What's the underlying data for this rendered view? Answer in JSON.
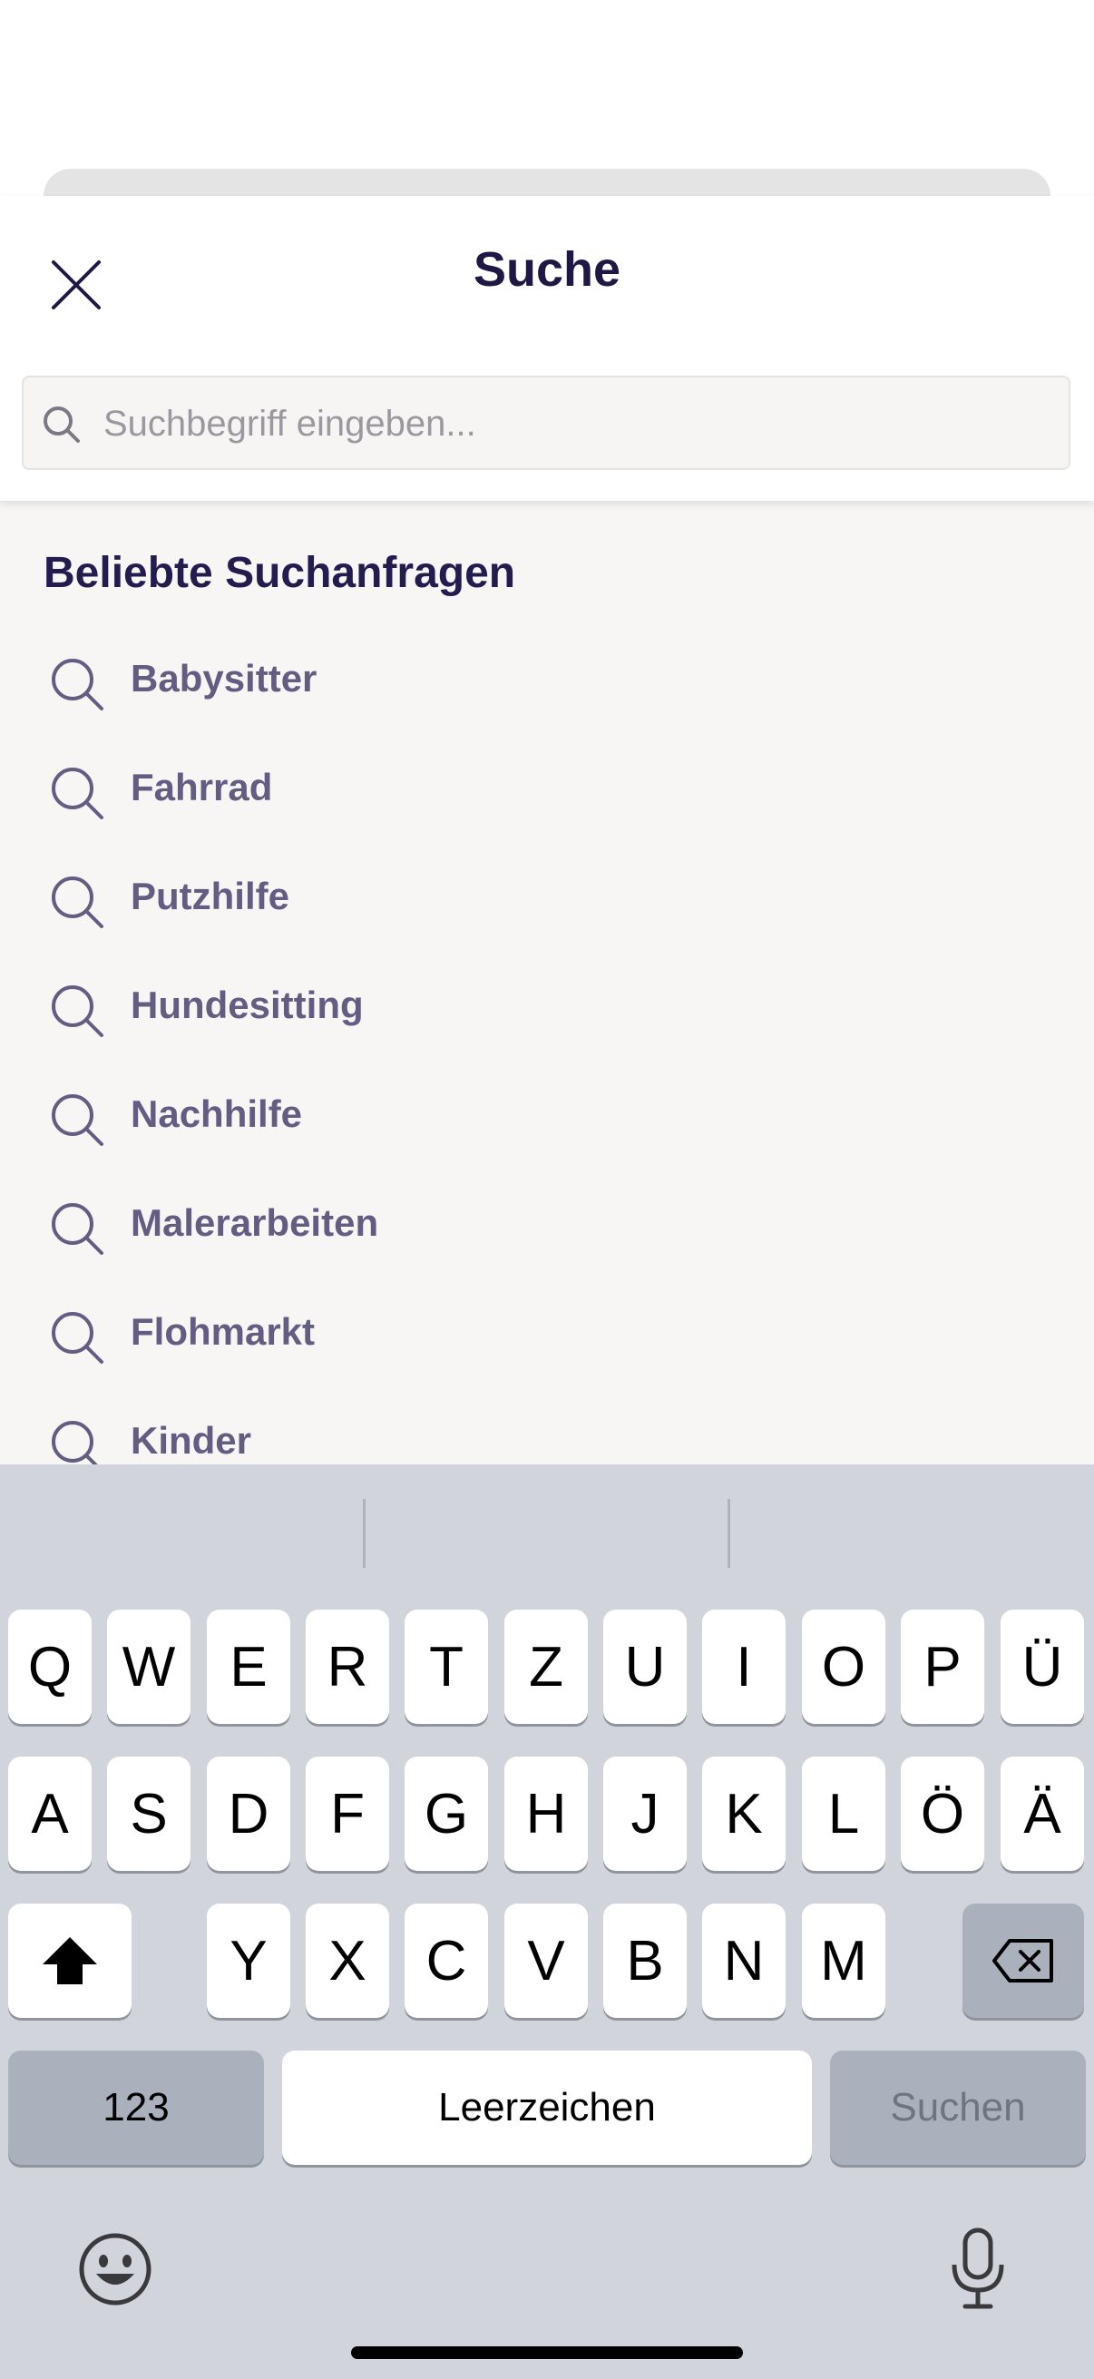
{
  "header": {
    "title": "Suche",
    "close_icon": "close-icon"
  },
  "search": {
    "placeholder": "Suchbegriff eingeben...",
    "value": "",
    "icon": "search-icon"
  },
  "popular": {
    "section_title": "Beliebte Suchanfragen",
    "items": [
      {
        "label": "Babysitter"
      },
      {
        "label": "Fahrrad"
      },
      {
        "label": "Putzhilfe"
      },
      {
        "label": "Hundesitting"
      },
      {
        "label": "Nachhilfe"
      },
      {
        "label": "Malerarbeiten"
      },
      {
        "label": "Flohmarkt"
      },
      {
        "label": "Kinder"
      }
    ]
  },
  "keyboard": {
    "row1": [
      "Q",
      "W",
      "E",
      "R",
      "T",
      "Z",
      "U",
      "I",
      "O",
      "P",
      "Ü"
    ],
    "row2": [
      "A",
      "S",
      "D",
      "F",
      "G",
      "H",
      "J",
      "K",
      "L",
      "Ö",
      "Ä"
    ],
    "row3": [
      "Y",
      "X",
      "C",
      "V",
      "B",
      "N",
      "M"
    ],
    "numbers_label": "123",
    "space_label": "Leerzeichen",
    "return_label": "Suchen",
    "icons": [
      "shift-icon",
      "backspace-icon",
      "emoji-icon",
      "microphone-icon"
    ]
  },
  "colors": {
    "title": "#1f1845",
    "item_text": "#635d82",
    "content_bg": "#f7f6f4",
    "keyboard_bg": "#d1d4db"
  }
}
